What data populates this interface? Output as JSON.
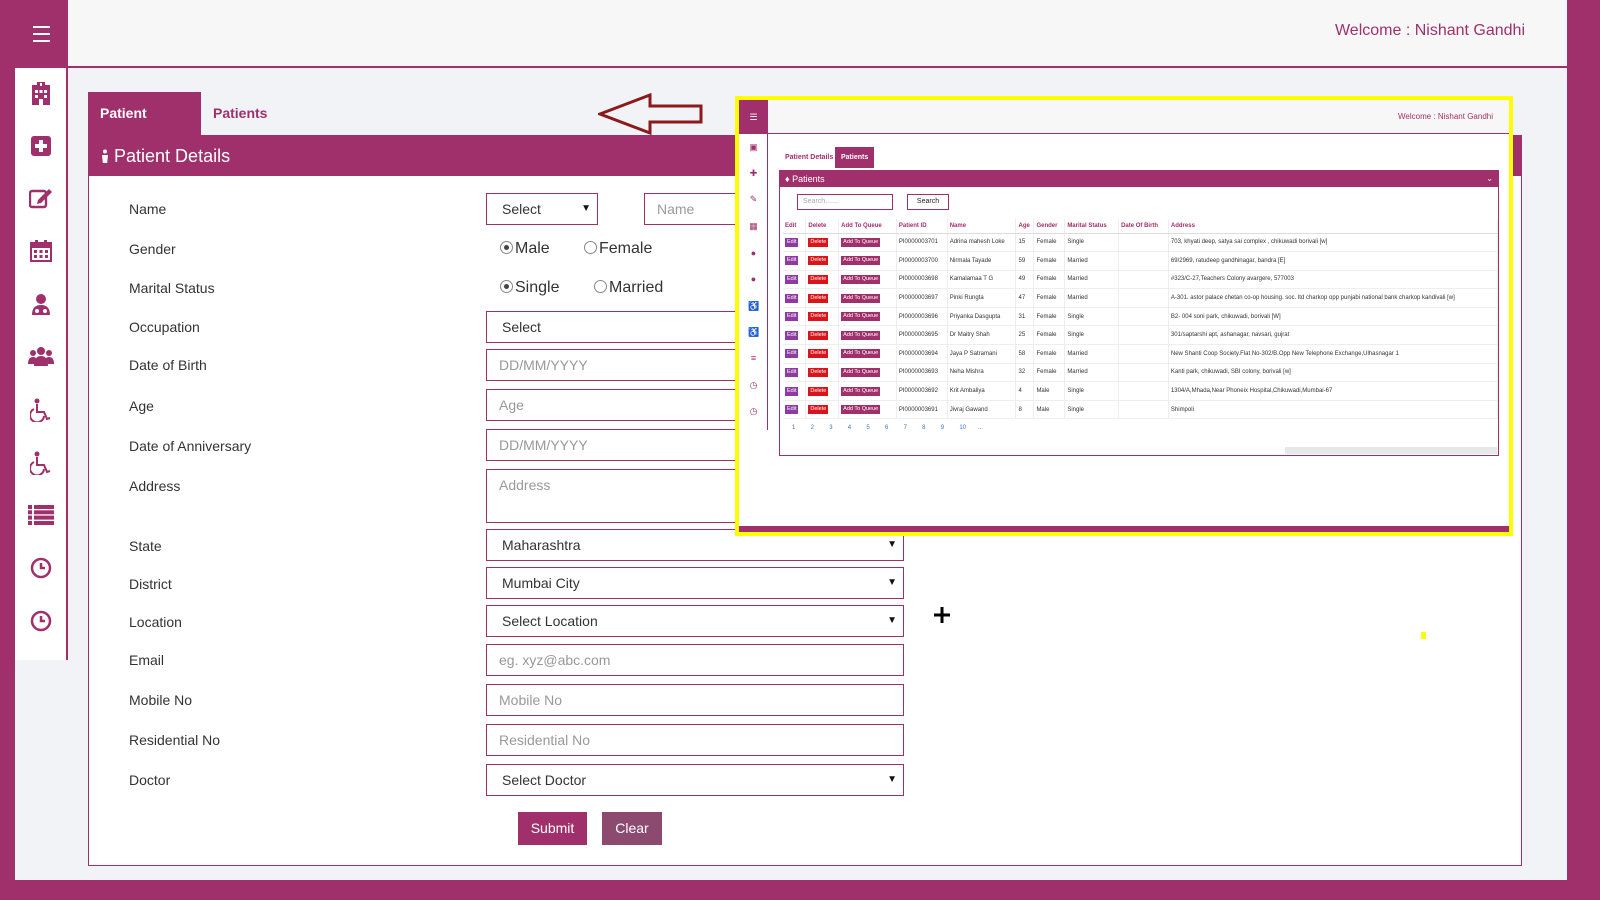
{
  "header": {
    "welcome_text": "Welcome : Nishant Gandhi",
    "menu_icon": "hamburger-icon"
  },
  "sidebar": {
    "items": [
      {
        "icon": "hospital-icon"
      },
      {
        "icon": "medical-plus-icon"
      },
      {
        "icon": "edit-icon"
      },
      {
        "icon": "calendar-icon"
      },
      {
        "icon": "doctor-icon"
      },
      {
        "icon": "users-group-icon"
      },
      {
        "icon": "wheelchair-icon"
      },
      {
        "icon": "wheelchair-icon"
      },
      {
        "icon": "list-icon"
      },
      {
        "icon": "clock-icon"
      },
      {
        "icon": "clock-icon"
      }
    ]
  },
  "tabs": {
    "patient_details": "Patient Details",
    "patients": "Patients",
    "active": "Patient Details"
  },
  "panel": {
    "title": "Patient Details",
    "title_icon": "person-icon"
  },
  "form": {
    "name_label": "Name",
    "title_select_value": "Select",
    "name_placeholder": "Name",
    "gender_label": "Gender",
    "gender_options": [
      "Male",
      "Female"
    ],
    "gender_selected": "Male",
    "marital_label": "Marital Status",
    "marital_options": [
      "Single",
      "Married"
    ],
    "marital_selected": "Single",
    "occupation_label": "Occupation",
    "occupation_value": "Select",
    "dob_label": "Date of Birth",
    "dob_placeholder": "DD/MM/YYYY",
    "age_label": "Age",
    "age_placeholder": "Age",
    "anniversary_label": "Date of Anniversary",
    "anniversary_placeholder": "DD/MM/YYYY",
    "address_label": "Address",
    "address_placeholder": "Address",
    "state_label": "State",
    "state_value": "Maharashtra",
    "district_label": "District",
    "district_value": "Mumbai City",
    "location_label": "Location",
    "location_value": "Select Location",
    "email_label": "Email",
    "email_placeholder": "eg. xyz@abc.com",
    "mobile_label": "Mobile No",
    "mobile_placeholder": "Mobile No",
    "residential_label": "Residential No",
    "residential_placeholder": "Residential No",
    "doctor_label": "Doctor",
    "doctor_value": "Select Doctor",
    "submit_label": "Submit",
    "clear_label": "Clear"
  },
  "overlay": {
    "welcome_text": "Welcome : Nishant Gandhi",
    "tab_patient_details": "Patient Details",
    "tab_patients": "Patients",
    "panel_title": "Patients",
    "search_placeholder": "Search.......",
    "search_button": "Search",
    "table": {
      "columns": [
        "Edit",
        "Delete",
        "Add To Queue",
        "Patient ID",
        "Name",
        "Age",
        "Gender",
        "Marital Status",
        "Date Of Birth",
        "Address"
      ],
      "row_actions": [
        "Edit",
        "Delete",
        "Add To Queue"
      ],
      "rows": [
        [
          "PI0000003701",
          "Adrina mahesh Loke",
          "15",
          "Female",
          "Single",
          "",
          "703, khyati deep, satya sai complex , chikuwadi borivali [w]"
        ],
        [
          "PI0000003700",
          "Nirmala Tayade",
          "59",
          "Female",
          "Married",
          "",
          "69/2969, ratudeep gandhinagar, bandra [E]"
        ],
        [
          "PI0000003698",
          "Kamalamaa T G",
          "49",
          "Female",
          "Married",
          "",
          "#323/C-27,Teachers Colony avargere, 577003"
        ],
        [
          "PI0000003697",
          "Pinki Rungta",
          "47",
          "Female",
          "Married",
          "",
          "A-301. astor palace chetan co-op housing. soc. ltd charkop opp punjabi national bank charkop kandivali [w]"
        ],
        [
          "PI0000003696",
          "Priyanka Dasgupta",
          "31",
          "Female",
          "Single",
          "",
          "B2- 004 soni park, chikuwadi, borivali [W]"
        ],
        [
          "PI0000003695",
          "Dr Maitry Shah",
          "25",
          "Female",
          "Single",
          "",
          "301/saptarshi apt, ashanagar, navsari, gujrat"
        ],
        [
          "PI0000003694",
          "Jaya P Satramani",
          "58",
          "Female",
          "Married",
          "",
          "New Shanti Coop Society.Flat No-302/B.Opp New Telephone Exchange,Ulhasnagar 1"
        ],
        [
          "PI0000003693",
          "Neha Mishra",
          "32",
          "Female",
          "Married",
          "",
          "Kanti park, chikuwadi, SBI colony, borivali [w]"
        ],
        [
          "PI0000003692",
          "Krit Ambaliya",
          "4",
          "Male",
          "Single",
          "",
          "1304/A,Mhada,Near Phoneix Hospital,Chikuwadi,Mumbai-67"
        ],
        [
          "PI0000003691",
          "Jivraj Gawand",
          "8",
          "Male",
          "Single",
          "",
          "Shimpoli"
        ]
      ]
    },
    "pagination": [
      "1",
      "2",
      "3",
      "4",
      "5",
      "6",
      "7",
      "8",
      "9",
      "10",
      "..."
    ]
  },
  "colors": {
    "brand": "#a0306b",
    "delete": "#d9141b",
    "edit": "#8e3aa0",
    "highlight": "#ffff00"
  }
}
